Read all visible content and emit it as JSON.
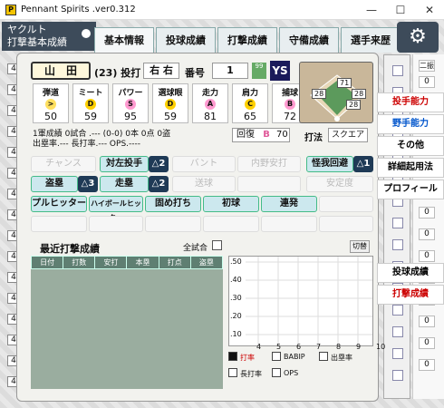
{
  "window": {
    "title": "Pennant Spirits .ver0.312",
    "app_icon": "P"
  },
  "team": {
    "line1": "ヤクルト",
    "line2": "打撃基本成績"
  },
  "tabs": [
    {
      "label": "基本情報"
    },
    {
      "label": "投球成績"
    },
    {
      "label": "打撃成績"
    },
    {
      "label": "守備成績"
    },
    {
      "label": "選手来歴"
    }
  ],
  "player": {
    "name": "山　田",
    "number_label": "(23) 投打",
    "bats_throws": "右 右",
    "no_label": "番号",
    "no_value": "1",
    "badge": "99"
  },
  "stats": [
    {
      "name": "弾道",
      "grade": ">",
      "value": "50",
      "color": "#ffe060"
    },
    {
      "name": "ミート",
      "grade": "D",
      "value": "59",
      "color": "#ffd000"
    },
    {
      "name": "パワー",
      "grade": "S",
      "value": "95",
      "color": "#ff9ad0"
    },
    {
      "name": "選球眼",
      "grade": "D",
      "value": "59",
      "color": "#ffd000"
    },
    {
      "name": "走力",
      "grade": "A",
      "value": "81",
      "color": "#ff9ad0"
    },
    {
      "name": "肩力",
      "grade": "C",
      "value": "65",
      "color": "#ffd000"
    },
    {
      "name": "捕球",
      "grade": "B",
      "value": "72",
      "color": "#ff9ad0"
    }
  ],
  "field": {
    "pos1": "28",
    "pos2": "71",
    "pos3": "28",
    "pos4": "28"
  },
  "info": {
    "line1": "1軍成績  0試合 .---  (0-0)  0本  0点  0盗",
    "line2": "出塁率.---  長打率.---  OPS.----"
  },
  "recover": {
    "label": "回復",
    "grade": "B",
    "value": "70"
  },
  "batting_style": {
    "label": "打法",
    "value": "スクエア"
  },
  "skills": {
    "row1": [
      "チャンス",
      "対左投手",
      "△2",
      "バント",
      "内野安打",
      "怪我回避",
      "△1"
    ],
    "row2": [
      "盗塁",
      "△3",
      "走塁",
      "△2",
      "送球",
      "安定度"
    ],
    "row3": [
      "プルヒッター",
      "ハイボールヒッター",
      "固め打ち",
      "初球",
      "連発"
    ]
  },
  "recent": {
    "title": "最近打撃成績",
    "all_games": "全試合",
    "switch": "切替",
    "columns": [
      "日付",
      "打数",
      "安打",
      "本塁",
      "打点",
      "盗塁"
    ]
  },
  "graph": {
    "y_ticks": [
      ".50",
      ".40",
      ".30",
      ".20",
      ".10"
    ],
    "x_ticks": [
      "4",
      "5",
      "6",
      "7",
      "8",
      "9",
      "10"
    ],
    "legend": [
      "打率",
      "BABIP",
      "出塁率",
      "長打率",
      "OPS"
    ]
  },
  "side_menu": [
    "投手能力",
    "野手能力",
    "その他",
    "詳細起用法",
    "プロフィール",
    "投球成績",
    "打撃成績"
  ],
  "left_numbers": [
    "4",
    "4",
    "4",
    "4",
    "4",
    "4",
    "4",
    "4",
    "4",
    "4",
    "4",
    "4",
    "4",
    "4",
    "4",
    "4"
  ],
  "right_header": "二振",
  "right_numbers": [
    "0",
    "0",
    "0",
    "0",
    "0",
    "0",
    "0",
    "0",
    "0",
    "0",
    "0",
    "0",
    "0",
    "0"
  ]
}
